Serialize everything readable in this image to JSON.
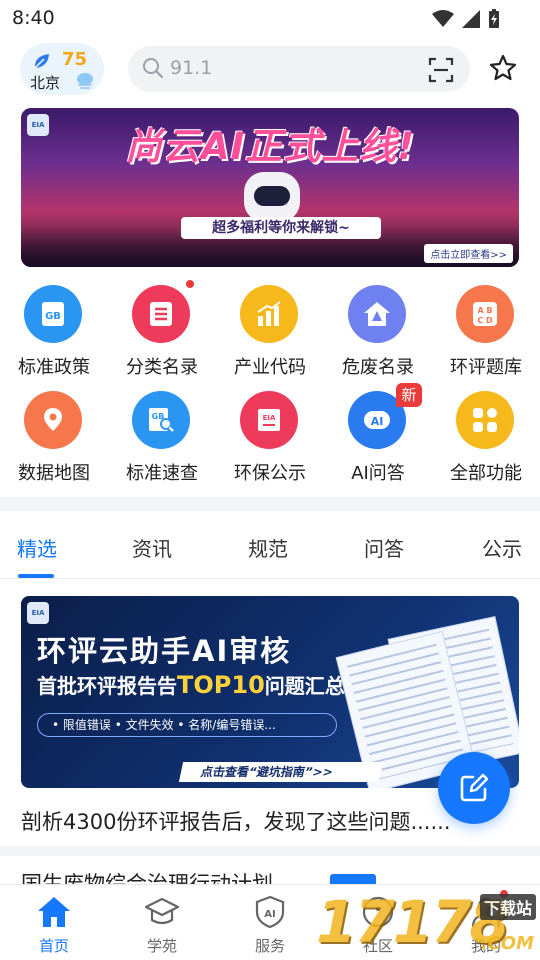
{
  "status_bar": {
    "time": "8:40"
  },
  "header": {
    "aqi_value": "75",
    "city": "北京",
    "search_placeholder": "91.1"
  },
  "banner": {
    "title": "尚云AI正式上线!",
    "subtitle": "超多福利等你来解锁~",
    "cta": "点击立即查看>>",
    "logo_text": "EIA"
  },
  "grid": {
    "items": [
      {
        "label": "标准政策",
        "icon": "gb-document-icon",
        "color": "#2b95f2"
      },
      {
        "label": "分类名录",
        "icon": "list-icon",
        "color": "#ef3b5b"
      },
      {
        "label": "产业代码",
        "icon": "bar-chart-icon",
        "color": "#f6b81a"
      },
      {
        "label": "危废名录",
        "icon": "hazard-house-icon",
        "color": "#6f80f0"
      },
      {
        "label": "环评题库",
        "icon": "abcd-icon",
        "color": "#f7774d"
      },
      {
        "label": "数据地图",
        "icon": "map-pin-icon",
        "color": "#f7774d"
      },
      {
        "label": "标准速查",
        "icon": "gb-search-icon",
        "color": "#2b95f2"
      },
      {
        "label": "环保公示",
        "icon": "eia-board-icon",
        "color": "#ef3b5b"
      },
      {
        "label": "AI问答",
        "icon": "ai-icon",
        "color": "#2b7bf0"
      },
      {
        "label": "全部功能",
        "icon": "apps-icon",
        "color": "#f6b81a"
      }
    ],
    "new_badge": "新"
  },
  "tabs": [
    "精选",
    "资讯",
    "规范",
    "问答",
    "公示"
  ],
  "article": {
    "title1": "环评云助手AI审核",
    "title2_prefix": "首批环评报告告",
    "title2_highlight": "TOP10",
    "title2_suffix": "问题汇总",
    "tags": "• 限值错误  • 文件失效  • 名称/编号错误...",
    "cta": "点击查看“避坑指南”>>",
    "caption": "剖析4300份环评报告后，发现了这些问题......",
    "logo_text": "EIA"
  },
  "next_article_peek": "国生废物综合治理行动计划",
  "bottom_nav": [
    {
      "label": "首页",
      "icon": "home-icon",
      "active": true
    },
    {
      "label": "学苑",
      "icon": "graduation-cap-icon",
      "active": false
    },
    {
      "label": "服务",
      "icon": "ai-shield-icon",
      "active": false
    },
    {
      "label": "社区",
      "icon": "community-icon",
      "active": false
    },
    {
      "label": "我的",
      "icon": "user-icon",
      "active": false
    }
  ],
  "watermark": {
    "number": "17178",
    "site": "下载站",
    "domain": ".COM"
  },
  "colors": {
    "accent": "#1677ff",
    "badge_red": "#ea3a3a",
    "aqi_yellow": "#f0a81a"
  }
}
